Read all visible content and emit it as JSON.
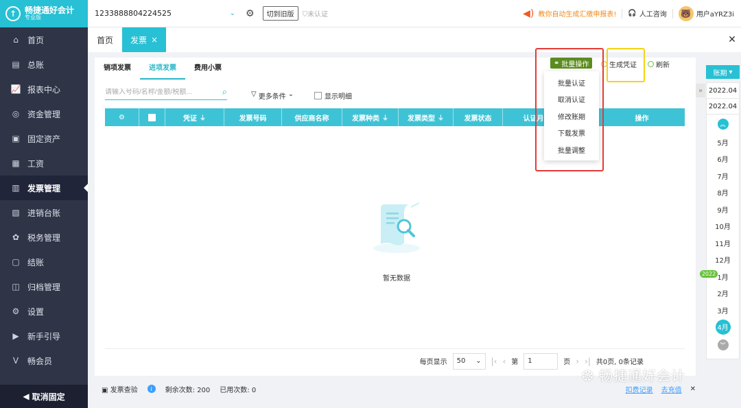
{
  "brand": {
    "name": "畅捷通好会计",
    "tier": "专业版"
  },
  "sidebar": {
    "items": [
      {
        "label": "首页",
        "icon": "home-icon"
      },
      {
        "label": "总账",
        "icon": "ledger-icon"
      },
      {
        "label": "报表中心",
        "icon": "chart-icon"
      },
      {
        "label": "资金管理",
        "icon": "wallet-icon"
      },
      {
        "label": "固定资产",
        "icon": "asset-icon"
      },
      {
        "label": "工资",
        "icon": "salary-icon"
      },
      {
        "label": "发票管理",
        "icon": "invoice-icon",
        "active": true
      },
      {
        "label": "进销台账",
        "icon": "account-book-icon"
      },
      {
        "label": "税务管理",
        "icon": "tax-icon"
      },
      {
        "label": "结账",
        "icon": "settle-icon"
      },
      {
        "label": "归档管理",
        "icon": "archive-icon"
      },
      {
        "label": "设置",
        "icon": "gear-icon"
      },
      {
        "label": "新手引导",
        "icon": "guide-icon"
      },
      {
        "label": "畅会员",
        "icon": "vip-icon"
      }
    ],
    "cancel_fixed": "取消固定"
  },
  "topbar": {
    "company": "1233888804224525",
    "switch_old": "切到旧版",
    "unverified": "未认证",
    "notice": "教你自动生成汇缴申报表!",
    "consult": "人工咨询",
    "user": "用户aYRZ3i"
  },
  "tabs": {
    "home": "首页",
    "invoice": "发票"
  },
  "subtabs": [
    "销项发票",
    "进项发票",
    "费用小票"
  ],
  "search": {
    "placeholder": "请输入号码/名称/金额/税额..."
  },
  "filters": {
    "more": "更多条件",
    "show_detail": "显示明细"
  },
  "table": {
    "headers": [
      "凭证",
      "发票号码",
      "供应商名称",
      "发票种类",
      "发票类型",
      "发票状态",
      "认证月份",
      "操作"
    ]
  },
  "empty": {
    "text": "暂无数据"
  },
  "pagination": {
    "per_page_label": "每页显示",
    "per_page": "50",
    "page_prefix": "第",
    "page": "1",
    "page_suffix": "页",
    "summary": "共0页, 0条记录"
  },
  "actions": {
    "batch": "批量操作",
    "batch_menu": [
      "批量认证",
      "取消认证",
      "修改账期",
      "下载发票",
      "批量调整"
    ],
    "generate_voucher": "生成凭证",
    "refresh": "刷新"
  },
  "period": {
    "button": "账期",
    "range_start": "2022.04",
    "range_end": "2022.04",
    "months": [
      "5月",
      "6月",
      "7月",
      "8月",
      "9月",
      "10月",
      "11月",
      "12月",
      "1月",
      "2月",
      "3月",
      "4月"
    ],
    "year_badge": "2022",
    "active_month": "4月"
  },
  "bottombar": {
    "check_label": "发票查验",
    "remaining": "剩余次数: 200",
    "used": "已用次数: 0",
    "deduct_record": "扣费记录",
    "recharge": "去充值"
  },
  "watermark": "畅捷通好会计",
  "colors": {
    "accent": "#27c0d4",
    "sidebar": "#2f3447",
    "batch_btn": "#5b8c1e",
    "notice": "#f08a1c"
  }
}
